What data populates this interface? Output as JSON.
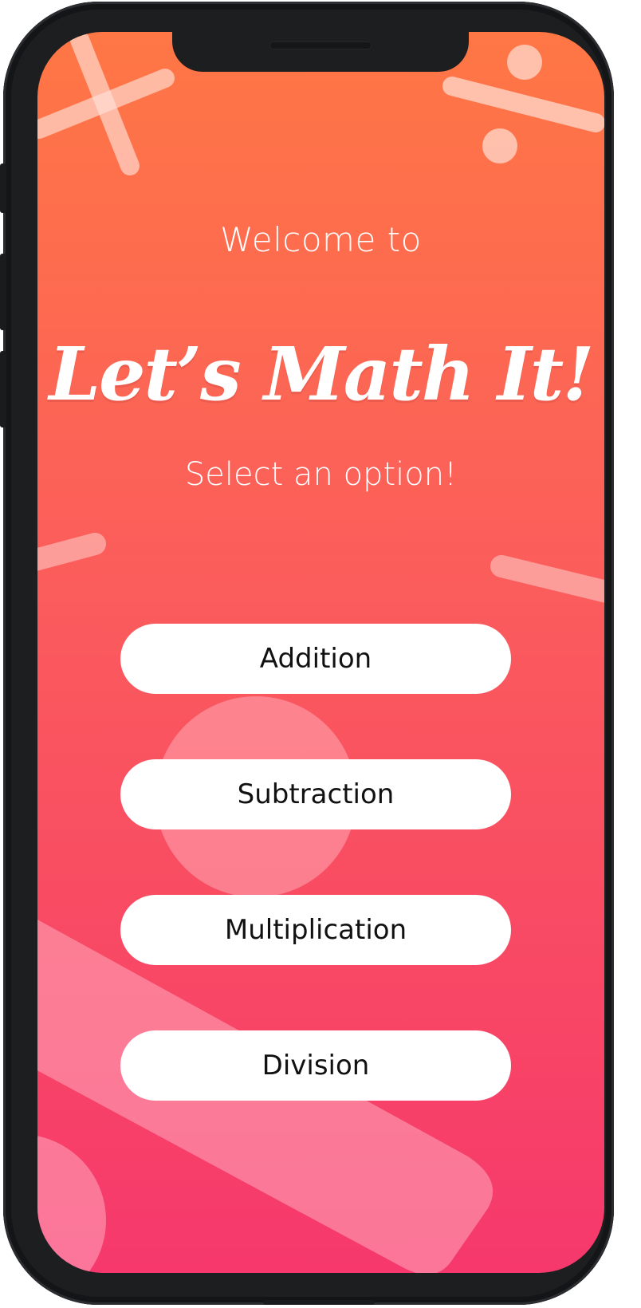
{
  "app": {
    "welcome_text": "Welcome to",
    "title": "Let’s Math It!",
    "subtitle": "Select an option!"
  },
  "options": [
    {
      "label": "Addition"
    },
    {
      "label": "Subtraction"
    },
    {
      "label": "Multiplication"
    },
    {
      "label": "Division"
    }
  ],
  "decorations": {
    "top_left": "multiplication-sign-icon",
    "top_right": "division-sign-icon"
  },
  "colors": {
    "gradient_top": "#ff7745",
    "gradient_mid": "#fb5c5c",
    "gradient_bottom": "#f6386c",
    "button_bg": "#ffffff",
    "button_text": "#111111",
    "text": "#ffffff"
  }
}
